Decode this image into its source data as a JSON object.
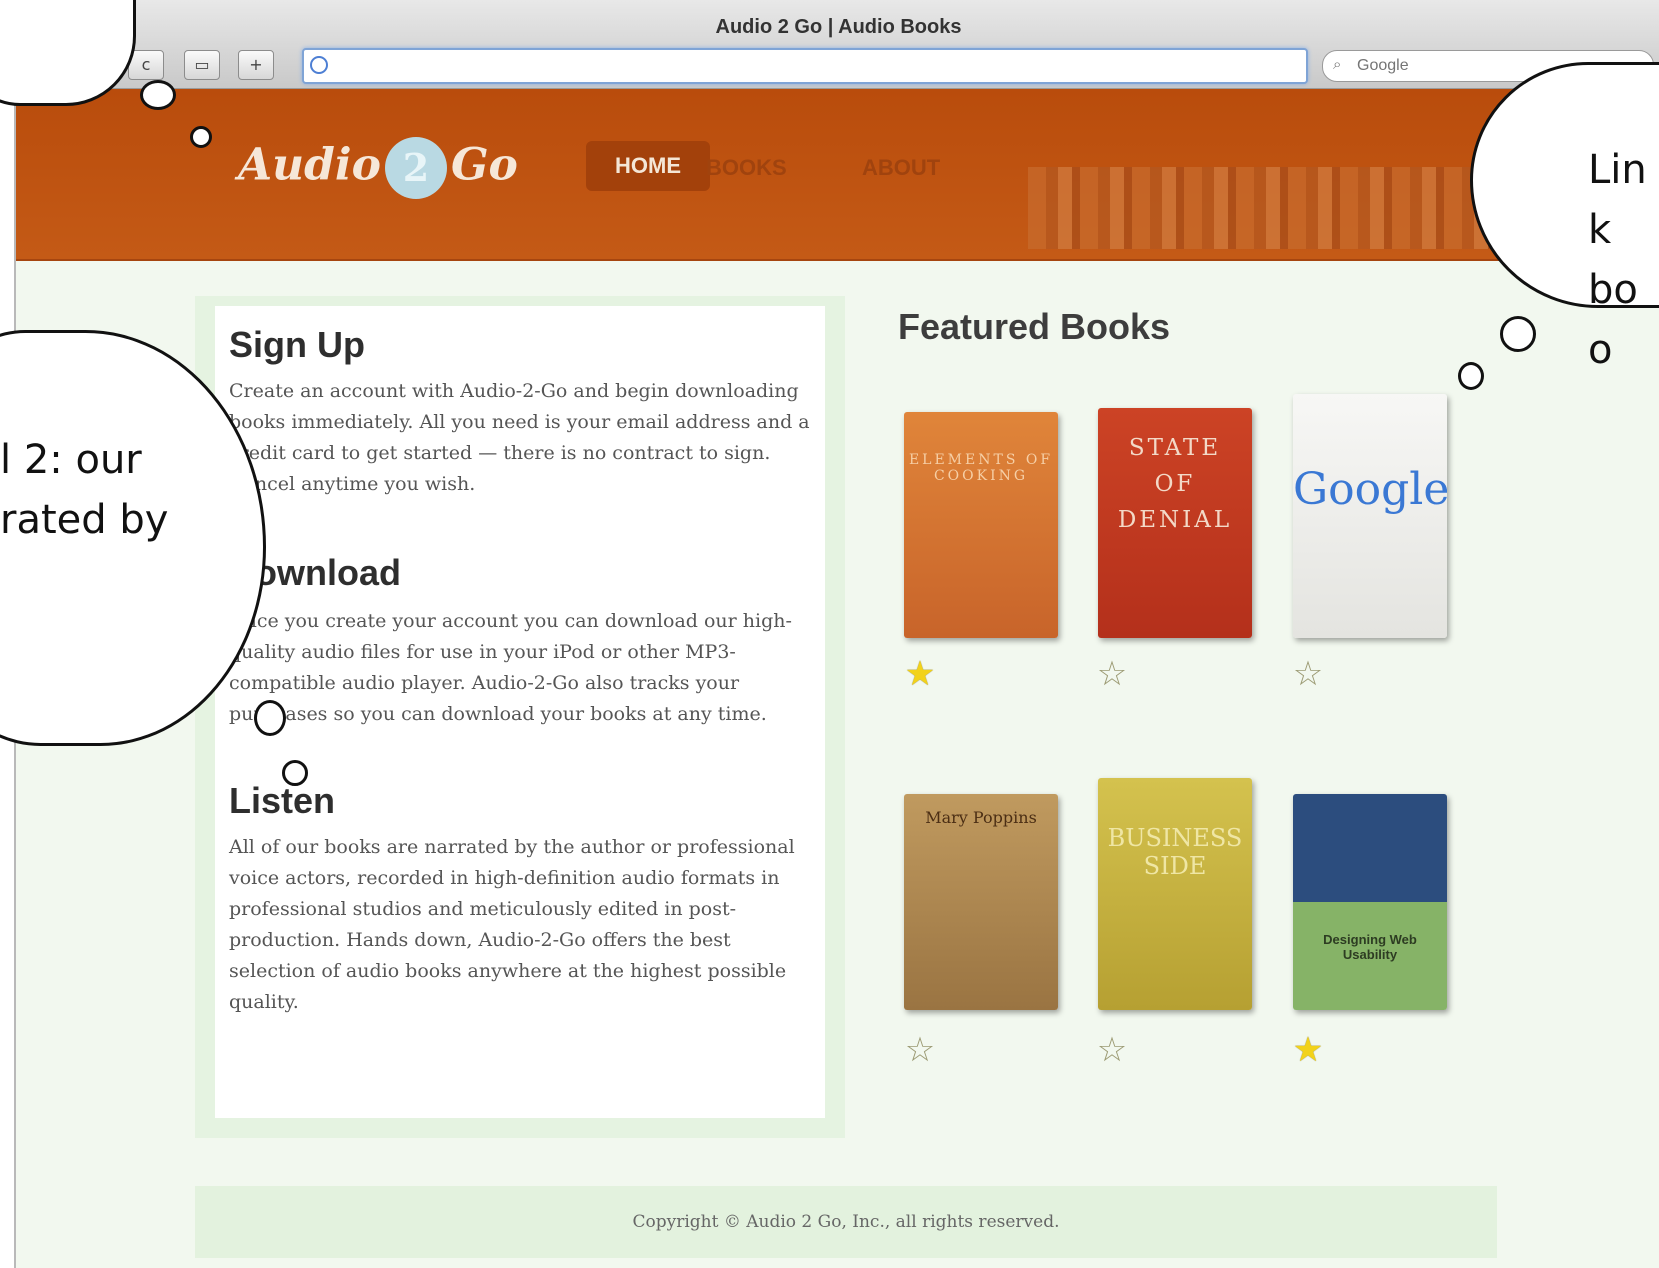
{
  "browser": {
    "title": "Audio 2 Go | Audio Books",
    "buttons": [
      "c",
      "▭",
      "+"
    ],
    "url": "",
    "search_placeholder": "Google"
  },
  "site": {
    "logo_left": "Audio",
    "logo_num": "2",
    "logo_right": "Go",
    "nav": {
      "home": "HOME",
      "books": "BOOKS",
      "about": "ABOUT"
    }
  },
  "sections": {
    "signup": {
      "title": "Sign Up",
      "text": "Create an account with Audio-2-Go and begin downloading books immediately. All you need is your email address and a credit card to get started — there is no contract to sign. Cancel anytime you wish."
    },
    "download": {
      "title": "Download",
      "text": "Once you create your account you can download our high-quality audio files for use in your iPod or other MP3-compatible audio player. Audio-2-Go also tracks your purchases so you can download your books at any time."
    },
    "listen": {
      "title": "Listen",
      "text": "All of our books are narrated by the author or professional voice actors, recorded in high-definition audio formats in professional studios and meticulously edited in post-production. Hands down, Audio-2-Go offers the best selection of audio books anywhere at the highest possible quality."
    }
  },
  "featured": {
    "title": "Featured Books",
    "books": [
      {
        "cover_text": "ELEMENTS OF COOKING",
        "color": "#d9742e",
        "starred": true
      },
      {
        "cover_text": "STATE OF DENIAL",
        "color": "#c0391d",
        "starred": false
      },
      {
        "cover_text": "Google",
        "color": "#f1f1ef",
        "starred": false
      },
      {
        "cover_text": "Mary Poppins",
        "color": "#b48a4f",
        "starred": false
      },
      {
        "cover_text": "BUSINESS SIDE",
        "color": "#c9b23a",
        "starred": false
      },
      {
        "cover_text": "Designing Web Usability",
        "color": "#7fae5f",
        "starred": true
      }
    ]
  },
  "footer": {
    "text": "Copyright © Audio 2 Go, Inc., all rights reserved."
  },
  "annotations": {
    "top_right": "Link boo",
    "left": "l 2: our rated by"
  },
  "colors": {
    "header": "#c0540f",
    "page_bg": "#f2f8ef",
    "panel": "#e5f3e1",
    "star": "#f2d21a"
  }
}
